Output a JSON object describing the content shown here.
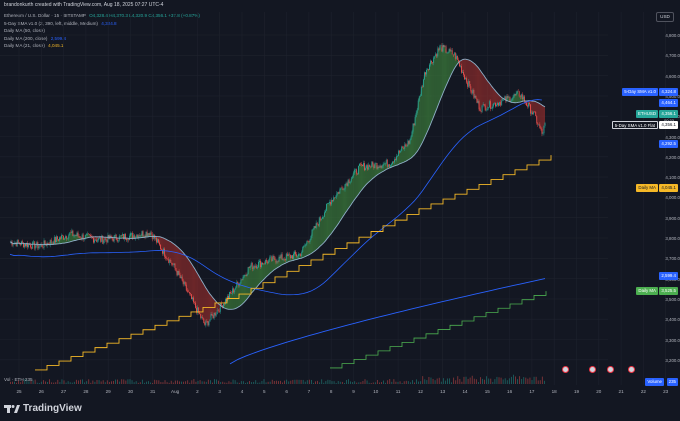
{
  "header": {
    "credit": "brandonkurth created with TradingView.com, Aug 18, 2025 07:27 UTC-4"
  },
  "legend": {
    "symbol": "Ethereum / U.S. Dollar · 15 · BITSTAMP",
    "ohlc": "O4,328.4 H4,370.3 L4,320.9 C4,356.1 +37.8 (+0.87%)",
    "sma": "5-Day SMA v1.0 (2, 390, left, middle, Medium)",
    "sma_value": "4,324.8",
    "ma50": "Daily MA (50, close)",
    "ma50_value": "",
    "ma200": "Daily MA (200, close)",
    "ma200_value": "2,599.4",
    "ma21": "Daily MA (21, close)",
    "ma21_value": "4,045.1"
  },
  "currency": "USD",
  "price_axis": [
    "4,800.0",
    "4,700.0",
    "4,600.0",
    "4,500.0",
    "4,400.0",
    "4,300.0",
    "4,200.0",
    "4,100.0",
    "4,000.0",
    "3,900.0",
    "3,800.0",
    "3,700.0",
    "3,600.0",
    "3,500.0",
    "3,400.0",
    "3,300.0",
    "3,200.0"
  ],
  "tags": {
    "sma_label": "5-Day SMA v1.0",
    "sma_value": "4,324.8",
    "tag_4464": "4,464.1",
    "symbol_label": "ETHUSD",
    "symbol_value": "4,356.1",
    "symbol_sub": "00:33",
    "sma_flat_label": "5-Day SMA v1.0 Flat",
    "sma_flat_value": "4,356.1",
    "tag_4292": "4,292.5",
    "daily_ma_label": "Daily MA",
    "daily_ma_value": "4,045.1",
    "tag_2599": "2,599.4",
    "daily_ma2_label": "Daily MA",
    "daily_ma2_value": "3,525.5",
    "volume_label": "Volume",
    "volume_value": "235"
  },
  "time_axis": [
    "25",
    "26",
    "27",
    "28",
    "29",
    "30",
    "31",
    "Aug",
    "2",
    "3",
    "4",
    "5",
    "6",
    "7",
    "8",
    "9",
    "10",
    "11",
    "12",
    "13",
    "14",
    "15",
    "16",
    "17",
    "18",
    "19",
    "20",
    "21",
    "22",
    "23"
  ],
  "volume_indicator": "Vol · ETH  235",
  "brand": "TradingView",
  "colors": {
    "background": "#131722",
    "up": "#26a69a",
    "down": "#ef5350",
    "ma21": "#f5b827",
    "ma200": "#2962ff",
    "sma_cloud_up": "#3b7a3b",
    "sma_cloud_down": "#8b2c2c",
    "ma_green": "#4caf50"
  },
  "icons": [
    "tradingview-logo-icon",
    "economic-event-icon"
  ]
}
